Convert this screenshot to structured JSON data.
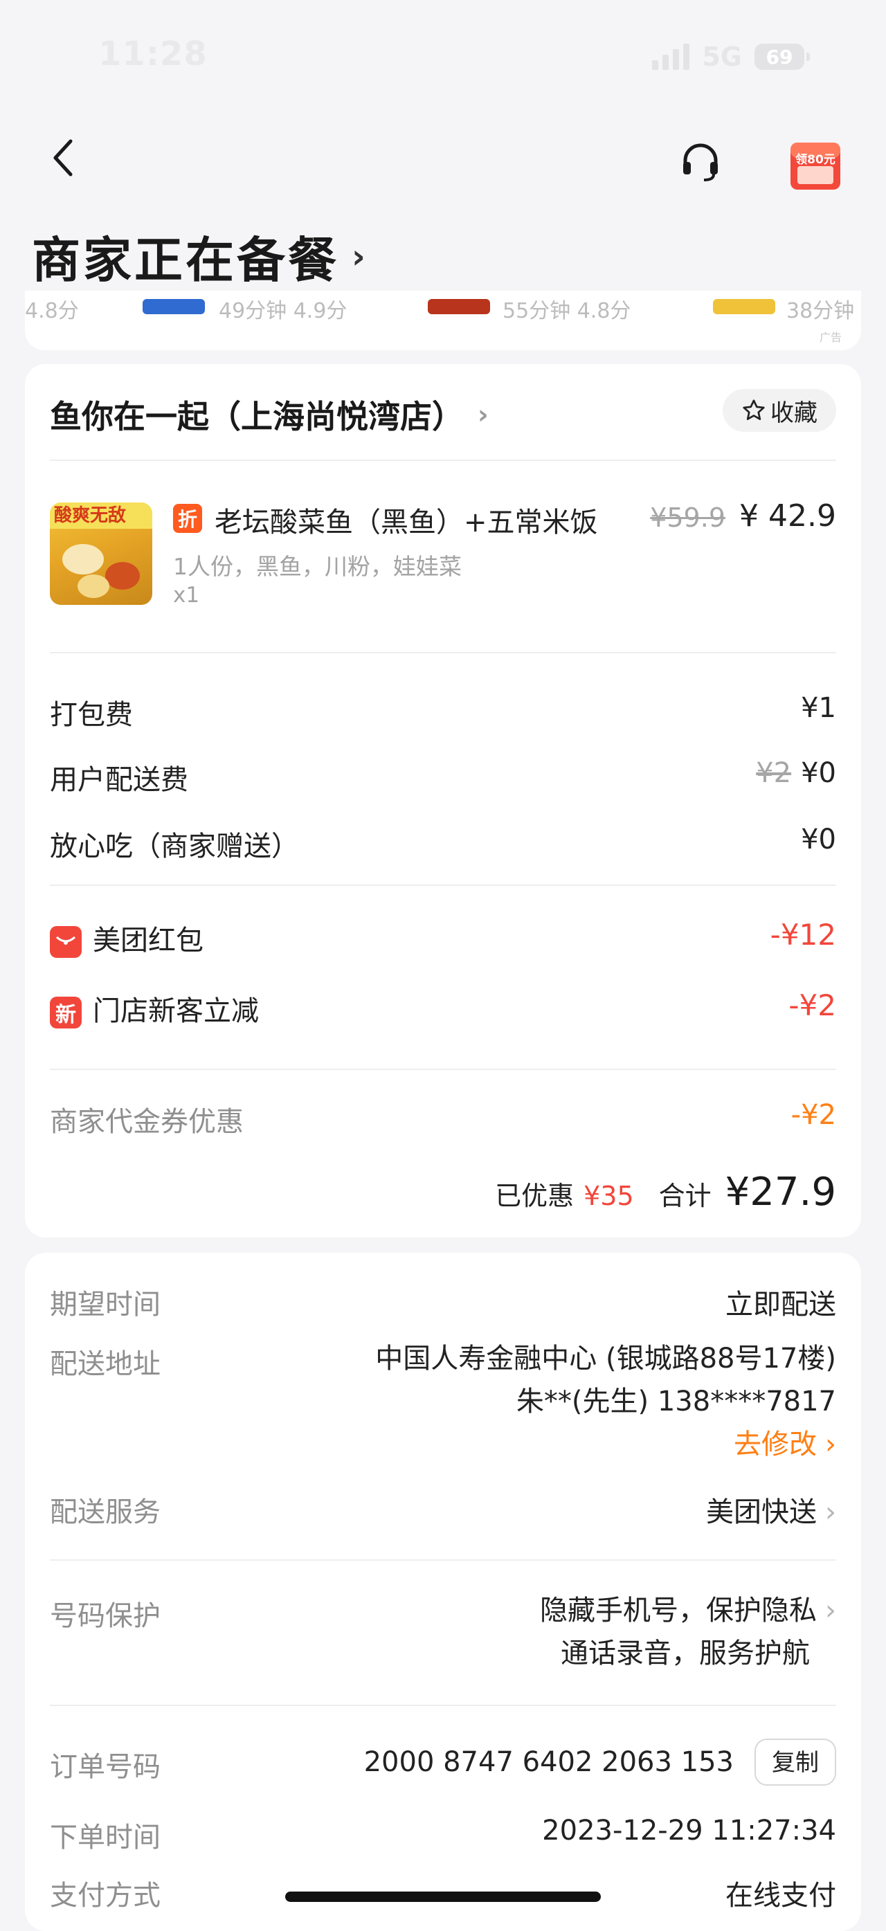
{
  "status_bar": {
    "time": "11:28",
    "network": "5G",
    "battery": "69"
  },
  "nav": {
    "title": "商家正在备餐",
    "promo_badge": "领80元"
  },
  "ad_strip": {
    "items": [
      "4.8分",
      "49分钟  4.9分",
      "55分钟  4.8分",
      "38分钟"
    ],
    "ad_tag": "广告"
  },
  "store": {
    "name": "鱼你在一起（上海尚悦湾店）",
    "favorite_label": "收藏"
  },
  "dish": {
    "image_text": "酸爽无敌",
    "badge": "折",
    "name": "老坛酸菜鱼（黑鱼）+五常米饭",
    "spec": "1人份，黑鱼，川粉，娃娃菜",
    "qty": "x1",
    "original_price": "¥59.9",
    "price": "¥ 42.9"
  },
  "fees": [
    {
      "label": "打包费",
      "original": "",
      "value": "¥1"
    },
    {
      "label": "用户配送费",
      "original": "¥2",
      "value": "¥0"
    },
    {
      "label": "放心吃（商家赠送）",
      "original": "",
      "value": "¥0"
    }
  ],
  "discounts": [
    {
      "icon": "",
      "label": "美团红包",
      "value": "-¥12"
    },
    {
      "icon": "新",
      "label": "门店新客立减",
      "value": "-¥2"
    }
  ],
  "voucher": {
    "label": "商家代金券优惠",
    "value": "-¥2"
  },
  "totals": {
    "saved_label": "已优惠",
    "saved_amount": "¥35",
    "total_label": "合计",
    "total_amount": "¥27.9"
  },
  "order_info": {
    "expected_time_label": "期望时间",
    "expected_time_value": "立即配送",
    "address_label": "配送地址",
    "address_line1": "中国人寿金融中心 (银城路88号17楼)",
    "address_line2": "朱**(先生) 138****7817",
    "modify_label": "去修改",
    "delivery_service_label": "配送服务",
    "delivery_service_value": "美团快送",
    "privacy_label": "号码保护",
    "privacy_line1": "隐藏手机号，保护隐私",
    "privacy_line2": "通话录音，服务护航",
    "order_no_label": "订单号码",
    "order_no_value": "2000 8747 6402 2063 153",
    "copy_label": "复制",
    "order_time_label": "下单时间",
    "order_time_value": "2023-12-29 11:27:34",
    "payment_label": "支付方式",
    "payment_value": "在线支付"
  }
}
